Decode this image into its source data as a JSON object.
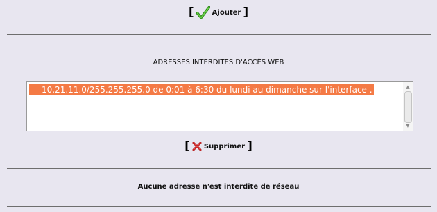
{
  "add_button": {
    "bracket_open": "[",
    "label": "Ajouter",
    "bracket_close": "]",
    "icon": "checkmark-icon"
  },
  "web_section": {
    "title": "ADRESSES INTERDITES D'ACCÈS WEB",
    "entries": [
      "10.21.11.0/255.255.255.0 de 0:01 à 6:30 du lundi au dimanche sur l'interface ."
    ],
    "selected_color": "#f47a45"
  },
  "delete_button": {
    "bracket_open": "[",
    "label": "Supprimer",
    "bracket_close": "]",
    "icon": "cross-icon"
  },
  "network_section": {
    "status": "Aucune adresse n'est interdite de réseau"
  }
}
